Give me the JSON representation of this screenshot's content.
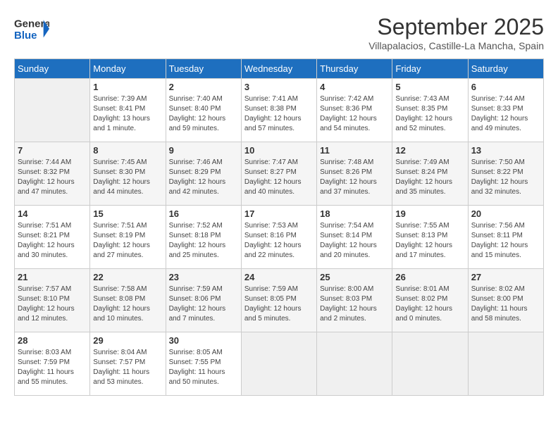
{
  "header": {
    "logo_general": "General",
    "logo_blue": "Blue",
    "month_year": "September 2025",
    "location": "Villapalacios, Castille-La Mancha, Spain"
  },
  "days_of_week": [
    "Sunday",
    "Monday",
    "Tuesday",
    "Wednesday",
    "Thursday",
    "Friday",
    "Saturday"
  ],
  "weeks": [
    [
      {
        "day": "",
        "info": ""
      },
      {
        "day": "1",
        "info": "Sunrise: 7:39 AM\nSunset: 8:41 PM\nDaylight: 13 hours\nand 1 minute."
      },
      {
        "day": "2",
        "info": "Sunrise: 7:40 AM\nSunset: 8:40 PM\nDaylight: 12 hours\nand 59 minutes."
      },
      {
        "day": "3",
        "info": "Sunrise: 7:41 AM\nSunset: 8:38 PM\nDaylight: 12 hours\nand 57 minutes."
      },
      {
        "day": "4",
        "info": "Sunrise: 7:42 AM\nSunset: 8:36 PM\nDaylight: 12 hours\nand 54 minutes."
      },
      {
        "day": "5",
        "info": "Sunrise: 7:43 AM\nSunset: 8:35 PM\nDaylight: 12 hours\nand 52 minutes."
      },
      {
        "day": "6",
        "info": "Sunrise: 7:44 AM\nSunset: 8:33 PM\nDaylight: 12 hours\nand 49 minutes."
      }
    ],
    [
      {
        "day": "7",
        "info": "Sunrise: 7:44 AM\nSunset: 8:32 PM\nDaylight: 12 hours\nand 47 minutes."
      },
      {
        "day": "8",
        "info": "Sunrise: 7:45 AM\nSunset: 8:30 PM\nDaylight: 12 hours\nand 44 minutes."
      },
      {
        "day": "9",
        "info": "Sunrise: 7:46 AM\nSunset: 8:29 PM\nDaylight: 12 hours\nand 42 minutes."
      },
      {
        "day": "10",
        "info": "Sunrise: 7:47 AM\nSunset: 8:27 PM\nDaylight: 12 hours\nand 40 minutes."
      },
      {
        "day": "11",
        "info": "Sunrise: 7:48 AM\nSunset: 8:26 PM\nDaylight: 12 hours\nand 37 minutes."
      },
      {
        "day": "12",
        "info": "Sunrise: 7:49 AM\nSunset: 8:24 PM\nDaylight: 12 hours\nand 35 minutes."
      },
      {
        "day": "13",
        "info": "Sunrise: 7:50 AM\nSunset: 8:22 PM\nDaylight: 12 hours\nand 32 minutes."
      }
    ],
    [
      {
        "day": "14",
        "info": "Sunrise: 7:51 AM\nSunset: 8:21 PM\nDaylight: 12 hours\nand 30 minutes."
      },
      {
        "day": "15",
        "info": "Sunrise: 7:51 AM\nSunset: 8:19 PM\nDaylight: 12 hours\nand 27 minutes."
      },
      {
        "day": "16",
        "info": "Sunrise: 7:52 AM\nSunset: 8:18 PM\nDaylight: 12 hours\nand 25 minutes."
      },
      {
        "day": "17",
        "info": "Sunrise: 7:53 AM\nSunset: 8:16 PM\nDaylight: 12 hours\nand 22 minutes."
      },
      {
        "day": "18",
        "info": "Sunrise: 7:54 AM\nSunset: 8:14 PM\nDaylight: 12 hours\nand 20 minutes."
      },
      {
        "day": "19",
        "info": "Sunrise: 7:55 AM\nSunset: 8:13 PM\nDaylight: 12 hours\nand 17 minutes."
      },
      {
        "day": "20",
        "info": "Sunrise: 7:56 AM\nSunset: 8:11 PM\nDaylight: 12 hours\nand 15 minutes."
      }
    ],
    [
      {
        "day": "21",
        "info": "Sunrise: 7:57 AM\nSunset: 8:10 PM\nDaylight: 12 hours\nand 12 minutes."
      },
      {
        "day": "22",
        "info": "Sunrise: 7:58 AM\nSunset: 8:08 PM\nDaylight: 12 hours\nand 10 minutes."
      },
      {
        "day": "23",
        "info": "Sunrise: 7:59 AM\nSunset: 8:06 PM\nDaylight: 12 hours\nand 7 minutes."
      },
      {
        "day": "24",
        "info": "Sunrise: 7:59 AM\nSunset: 8:05 PM\nDaylight: 12 hours\nand 5 minutes."
      },
      {
        "day": "25",
        "info": "Sunrise: 8:00 AM\nSunset: 8:03 PM\nDaylight: 12 hours\nand 2 minutes."
      },
      {
        "day": "26",
        "info": "Sunrise: 8:01 AM\nSunset: 8:02 PM\nDaylight: 12 hours\nand 0 minutes."
      },
      {
        "day": "27",
        "info": "Sunrise: 8:02 AM\nSunset: 8:00 PM\nDaylight: 11 hours\nand 58 minutes."
      }
    ],
    [
      {
        "day": "28",
        "info": "Sunrise: 8:03 AM\nSunset: 7:59 PM\nDaylight: 11 hours\nand 55 minutes."
      },
      {
        "day": "29",
        "info": "Sunrise: 8:04 AM\nSunset: 7:57 PM\nDaylight: 11 hours\nand 53 minutes."
      },
      {
        "day": "30",
        "info": "Sunrise: 8:05 AM\nSunset: 7:55 PM\nDaylight: 11 hours\nand 50 minutes."
      },
      {
        "day": "",
        "info": ""
      },
      {
        "day": "",
        "info": ""
      },
      {
        "day": "",
        "info": ""
      },
      {
        "day": "",
        "info": ""
      }
    ]
  ]
}
